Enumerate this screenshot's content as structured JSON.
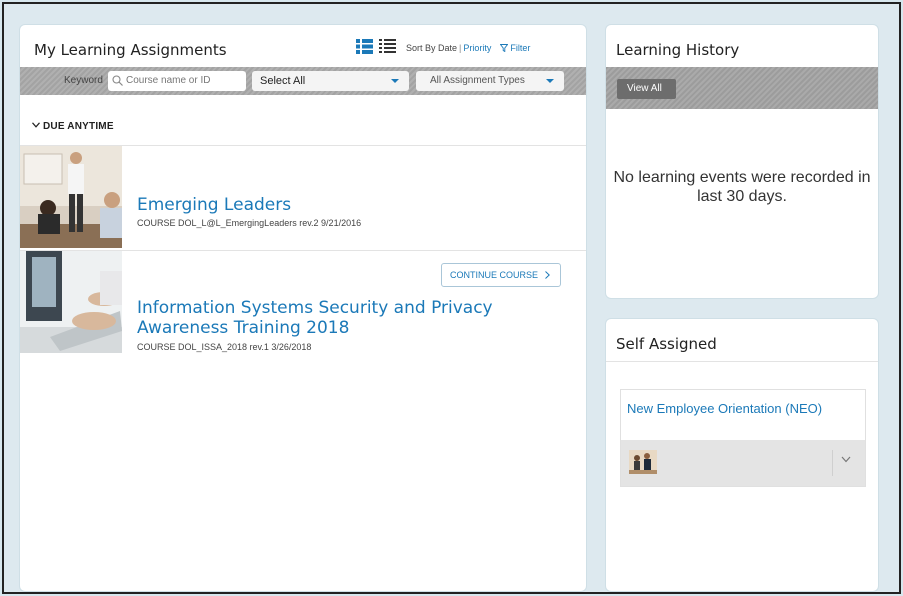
{
  "main": {
    "title": "My Learning Assignments",
    "sort_label": "Sort By Date",
    "sort_priority": "Priority",
    "filter_label": "Filter",
    "toolbar": {
      "keyword_label": "Keyword",
      "search_placeholder": "Course name or ID",
      "select_value": "Select All",
      "types_value": "All Assignment Types"
    },
    "due_section": "DUE ANYTIME",
    "courses": [
      {
        "title": "Emerging Leaders",
        "meta": "COURSE DOL_L@L_EmergingLeaders rev.2 9/21/2016"
      },
      {
        "title": "Information Systems Security and Privacy Awareness Training 2018",
        "meta": "COURSE DOL_ISSA_2018 rev.1 3/26/2018",
        "action": "CONTINUE COURSE"
      }
    ]
  },
  "history": {
    "title": "Learning History",
    "view_all": "View All",
    "empty_message": "No learning events were recorded in last 30 days."
  },
  "self_assigned": {
    "title": "Self Assigned",
    "item_title": "New Employee Orientation (NEO)"
  },
  "colors": {
    "link_blue": "#1b79b8",
    "background": "#d7e7ee"
  },
  "icons": [
    "list-view-icon",
    "compact-view-icon",
    "filter-icon",
    "search-icon",
    "chevron-down-icon",
    "chevron-right-icon"
  ]
}
